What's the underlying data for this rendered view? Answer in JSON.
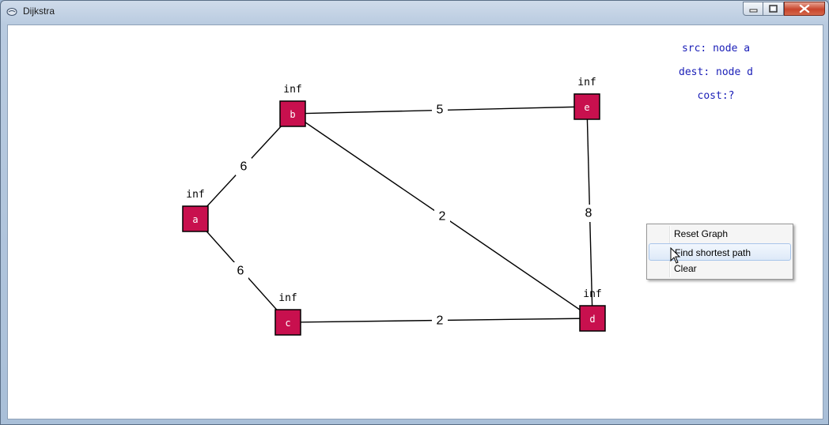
{
  "window": {
    "title": "Dijkstra",
    "icon": "app-icon"
  },
  "titlebar_controls": {
    "minimize_icon": "minimize-icon",
    "maximize_icon": "maximize-icon",
    "close_icon": "close-icon"
  },
  "info": {
    "src": "src: node a",
    "dest": "dest: node d",
    "cost": "cost:?"
  },
  "colors": {
    "node_fill": "#c8104e",
    "info_text": "#1c20b8"
  },
  "graph": {
    "nodes": [
      {
        "id": "a",
        "label": "a",
        "dist": "inf"
      },
      {
        "id": "b",
        "label": "b",
        "dist": "inf"
      },
      {
        "id": "c",
        "label": "c",
        "dist": "inf"
      },
      {
        "id": "d",
        "label": "d",
        "dist": "inf"
      },
      {
        "id": "e",
        "label": "e",
        "dist": "inf"
      }
    ],
    "edges": [
      {
        "from": "a",
        "to": "b",
        "weight": "6"
      },
      {
        "from": "a",
        "to": "c",
        "weight": "6"
      },
      {
        "from": "b",
        "to": "e",
        "weight": "5"
      },
      {
        "from": "b",
        "to": "d",
        "weight": "2"
      },
      {
        "from": "c",
        "to": "d",
        "weight": "2"
      },
      {
        "from": "e",
        "to": "d",
        "weight": "8"
      }
    ]
  },
  "context_menu": {
    "items": [
      {
        "label": "Reset Graph"
      },
      {
        "label": "Find shortest path",
        "highlighted": true
      },
      {
        "label": "Clear"
      }
    ]
  }
}
